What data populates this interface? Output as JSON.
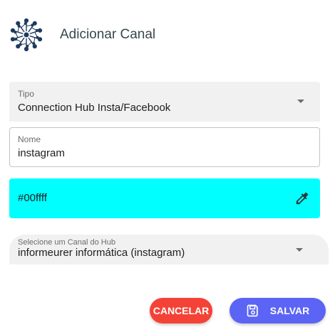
{
  "dialog": {
    "title": "Adicionar Canal"
  },
  "fields": {
    "tipo": {
      "label": "Tipo",
      "value": "Connection Hub Insta/Facebook"
    },
    "nome": {
      "label": "Nome",
      "value": "instagram"
    },
    "cor": {
      "value": "#00ffff"
    },
    "hub": {
      "label": "Selecione um Canal do Hub",
      "value": "informeurer informática (instagram)"
    }
  },
  "buttons": {
    "cancel_label": "CANCELAR",
    "save_label": "SALVAR"
  },
  "colors": {
    "field_color_swatch": "#00ffff",
    "cancel_button": "#f44336",
    "save_button": "#5b64f4",
    "logo": "#1e3a5f"
  },
  "icons": {
    "logo": "hub-network-icon",
    "tipo_dropdown": "caret-down-icon",
    "color_picker": "eyedropper-icon",
    "hub_dropdown": "caret-down-icon",
    "save": "floppy-disk-icon"
  }
}
